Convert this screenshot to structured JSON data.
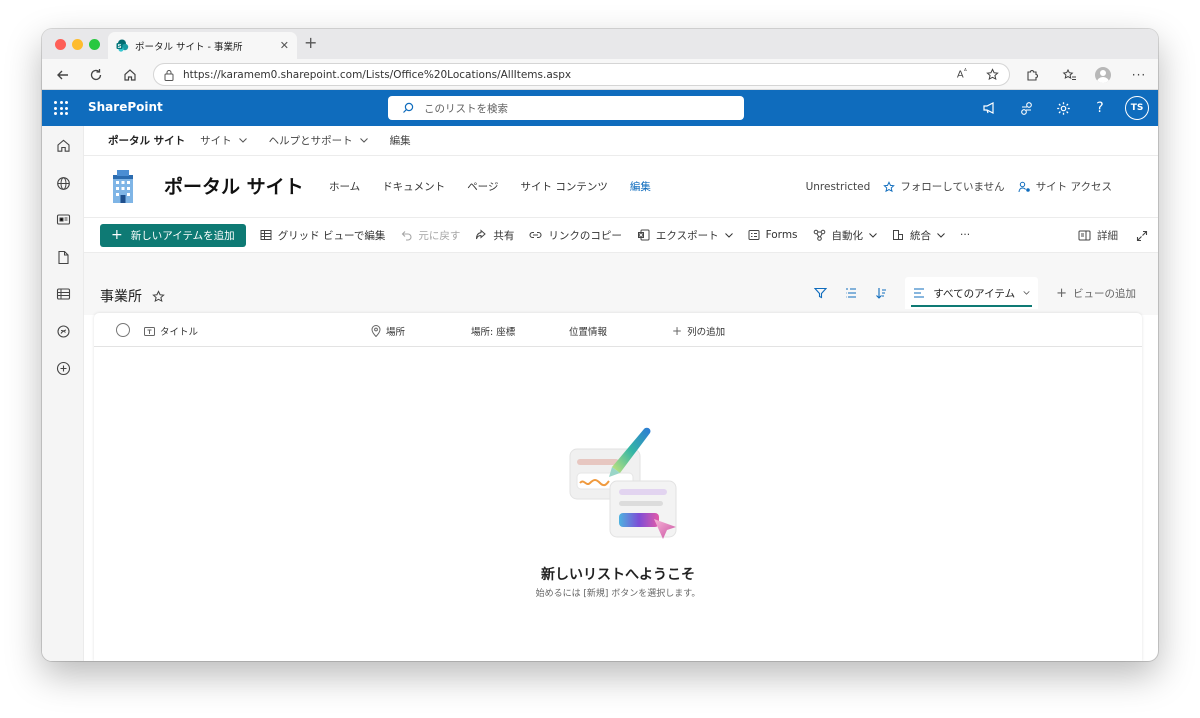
{
  "browser": {
    "tab_title": "ポータル サイト - 事業所",
    "url": "https://karamem0.sharepoint.com/Lists/Office%20Locations/AllItems.aspx"
  },
  "suite": {
    "app_name": "SharePoint",
    "search_placeholder": "このリストを検索",
    "user_initials": "TS",
    "bar_color": "#0f6cbd"
  },
  "hub_nav": {
    "site": "ポータル サイト",
    "items": [
      "サイト",
      "ヘルプとサポート",
      "編集"
    ]
  },
  "site_header": {
    "title": "ポータル サイト",
    "nav": [
      "ホーム",
      "ドキュメント",
      "ページ",
      "サイト コンテンツ",
      "編集"
    ],
    "sensitivity": "Unrestricted",
    "follow": "フォローしていません",
    "access": "サイト アクセス"
  },
  "command_bar": {
    "new_item": "新しいアイテムを追加",
    "grid_edit": "グリッド ビューで編集",
    "undo": "元に戻す",
    "share": "共有",
    "copy_link": "リンクのコピー",
    "export": "エクスポート",
    "forms": "Forms",
    "automate": "自動化",
    "integrate": "統合",
    "more": "···",
    "details": "詳細",
    "accent": "#0e7a74"
  },
  "list": {
    "name": "事業所",
    "current_view": "すべてのアイテム",
    "add_view": "ビューの追加",
    "columns": [
      "タイトル",
      "場所",
      "場所: 座標",
      "位置情報",
      "列の追加"
    ],
    "empty_title": "新しいリストへようこそ",
    "empty_subtitle": "始めるには [新規] ボタンを選択します。"
  }
}
